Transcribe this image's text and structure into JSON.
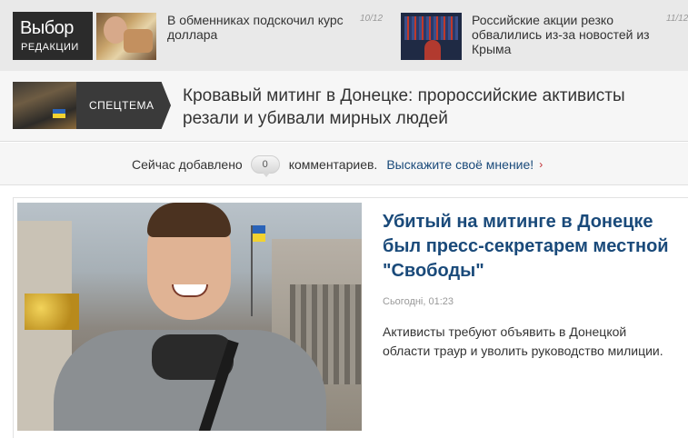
{
  "editors_choice": {
    "title": "Выбор",
    "subtitle": "РЕДАКЦИИ"
  },
  "top_news": [
    {
      "text": "В обменниках подскочил курс доллара",
      "date": "10/12"
    },
    {
      "text": "Российские акции резко обвалились из-за новостей из Крыма",
      "date": "11/12"
    }
  ],
  "special_topic": {
    "badge": "СПЕЦТЕМА",
    "title": "Кровавый митинг в Донецке: пророссийские активисты резали и убивали мирных людей"
  },
  "comments": {
    "prefix": "Сейчас добавлено",
    "count": "0",
    "suffix": "комментариев.",
    "cta": "Выскажите своё мнение!",
    "cta_arrow": "›"
  },
  "article": {
    "headline": "Убитый на митинге в Донецке был пресс-секретарем местной \"Свободы\"",
    "timestamp": "Сьогодні, 01:23",
    "lead": "Активисты требуют объявить в Донецкой области траур и уволить руководство милиции."
  },
  "colors": {
    "link_blue": "#1a4a7a",
    "badge_dark": "#2b2b2b",
    "arrow_red": "#c0282d"
  }
}
